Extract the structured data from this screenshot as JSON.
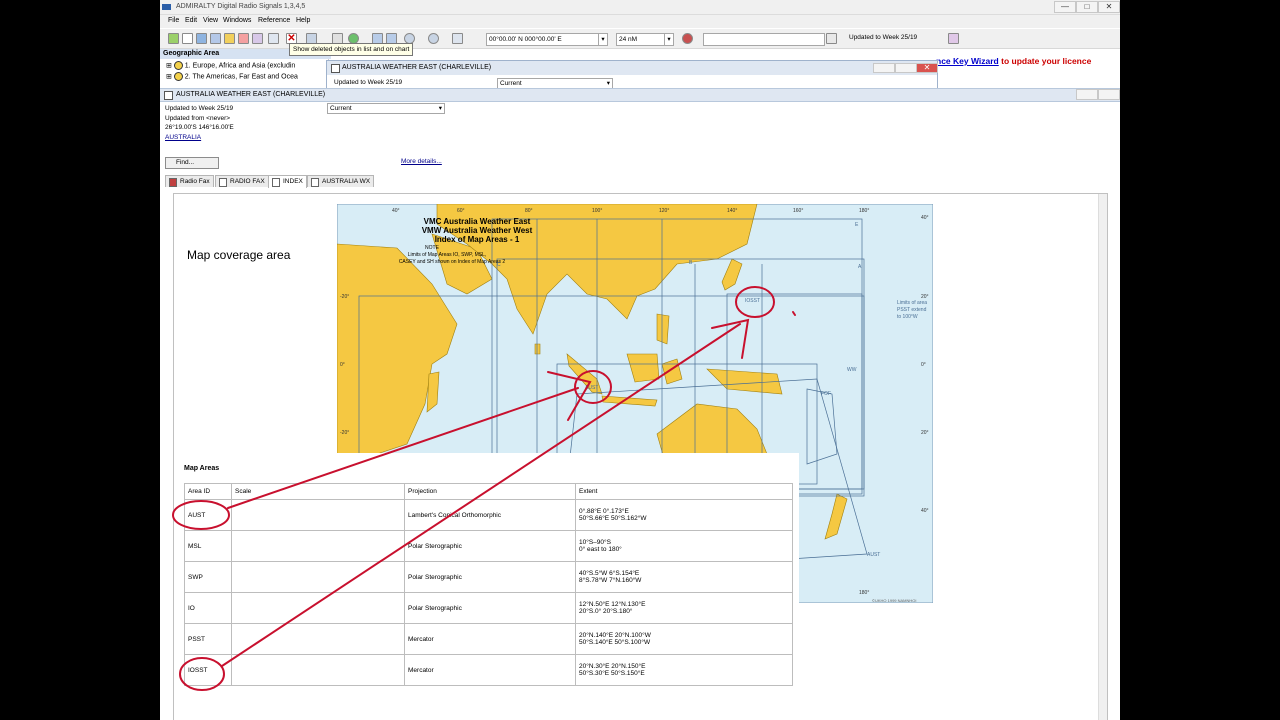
{
  "window": {
    "title": "ADMIRALTY Digital Radio Signals 1,3,4,5",
    "controls": [
      "—",
      "□",
      "✕"
    ]
  },
  "menu": [
    "File",
    "Edit",
    "View",
    "Windows",
    "Reference",
    "Help"
  ],
  "toolbar": {
    "tooltip": "Show deleted objects in list and on chart",
    "position": "00°00.00' N 000°00.00' E",
    "range": "24 nM",
    "search_value": "",
    "update_status": "Updated to Week 25/19"
  },
  "geographic_area": {
    "header": "Geographic Area",
    "items": [
      {
        "expander": "⊞",
        "label": "1. Europe, Africa and Asia (excludin"
      },
      {
        "expander": "⊞",
        "label": "2. The Americas, Far East and Ocea"
      }
    ]
  },
  "licence_banner": {
    "link": "nce Key Wizard",
    "text": " to update your licence"
  },
  "inner_window": {
    "title": "AUSTRALIA WEATHER EAST (CHARLEVILLE)",
    "updated": "Updated to Week 25/19",
    "select": "Current"
  },
  "document": {
    "title": "AUSTRALIA WEATHER EAST (CHARLEVILLE)",
    "updated_to": "Updated to Week 25/19",
    "updated_from": "Updated from <never>",
    "position": "26°19.00'S 146°16.00'E",
    "country_link": "AUSTRALIA",
    "select": "Current",
    "find_button": "Find...",
    "more_details": "More details..."
  },
  "tabs": [
    {
      "label": "Radio Fax",
      "active": false
    },
    {
      "label": "RADIO FAX",
      "active": false
    },
    {
      "label": "INDEX",
      "active": true
    },
    {
      "label": "AUSTRALIA WX",
      "active": false
    }
  ],
  "coverage_heading": "Map coverage area",
  "map": {
    "title_lines": [
      "VMC Australia Weather East",
      "VMW Australia Weather West",
      "Index of Map Areas - 1"
    ],
    "note_lines": [
      "NOTE",
      "Limits of Map Areas IO, SWP, MSL,",
      "CASEY and SH shown on Index of Map Areas 2"
    ],
    "top_longitudes": [
      "40°",
      "60°",
      "80°",
      "100°",
      "120°",
      "140°",
      "160°",
      "180°"
    ],
    "bottom_longitude": "180°",
    "left_latitudes": [
      "-20°",
      "0°",
      "-20°"
    ],
    "right_latitudes": [
      "40°",
      "20°",
      "0°",
      "20°",
      "40°"
    ],
    "area_letters": [
      "E",
      "C",
      "B",
      "A",
      "WW",
      "FOF"
    ],
    "area_labels": [
      "IOSST",
      "AUST",
      "AUST"
    ],
    "pss_note": [
      "Limits of area",
      "PSST extend",
      "to 100°W"
    ],
    "copyright": "©UKHO 1999 NAMNHOI"
  },
  "map_areas": {
    "heading": "Map Areas",
    "headers": [
      "Area ID",
      "Scale",
      "Projection",
      "Extent"
    ],
    "rows": [
      {
        "id": "AUST",
        "scale": "",
        "projection": "Lambert's Conical Orthomorphic",
        "extent1": "0°.88°E 0°.173°E",
        "extent2": "50°S.66°E 50°S.162°W"
      },
      {
        "id": "MSL",
        "scale": "",
        "projection": "Polar Sterographic",
        "extent1": "10°S–90°S",
        "extent2": "0° east to 180°"
      },
      {
        "id": "SWP",
        "scale": "",
        "projection": "Polar Sterographic",
        "extent1": "40°S.5°W 6°S.154°E",
        "extent2": "8°S.78°W 7°N.160°W"
      },
      {
        "id": "IO",
        "scale": "",
        "projection": "Polar Sterographic",
        "extent1": "12°N.50°E 12°N.130°E",
        "extent2": "20°S.0° 20°S.180°"
      },
      {
        "id": "PSST",
        "scale": "",
        "projection": "Mercator",
        "extent1": "20°N.140°E 20°N.100°W",
        "extent2": "50°S.140°E 50°S.100°W"
      },
      {
        "id": "IOSST",
        "scale": "",
        "projection": "Mercator",
        "extent1": "20°N.30°E 20°N.150°E",
        "extent2": "50°S.30°E 50°S.150°E"
      }
    ]
  },
  "colors": {
    "land": "#f5c842",
    "sea": "#d8edf6",
    "annotation": "#c8102e",
    "chrome": "#f0f0f0",
    "link": "#00008b",
    "licence_text": "#cc0000"
  }
}
